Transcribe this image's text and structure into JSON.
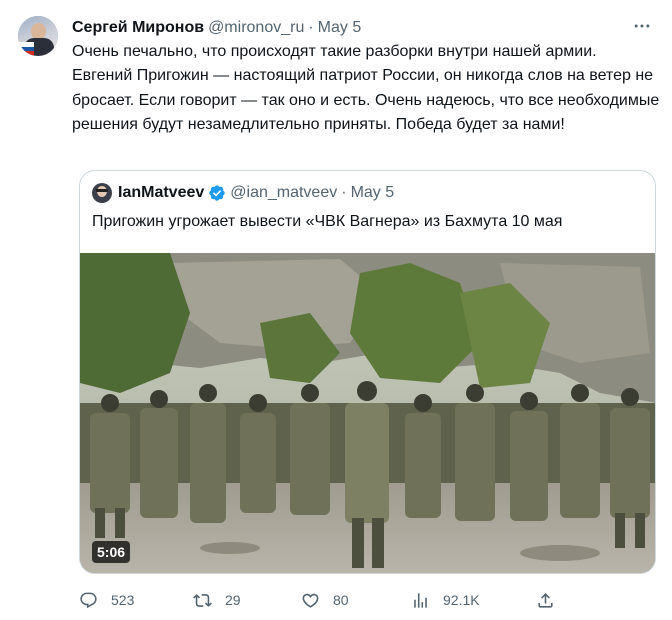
{
  "tweet": {
    "author_name": "Сергей Миронов",
    "handle": "@mironov_ru",
    "separator": "·",
    "date": "May 5",
    "avatar_icon": "profile-photo-with-russian-flag",
    "text": "Очень печально, что происходят такие разборки внутри нашей армии. Евгений Пригожин — настоящий патриот России, он никогда слов на ветер не бросает. Если говорит — так оно и есть. Очень надеюсь, что все необходимые решения будут незамедлительно приняты. Победа будет за нами!"
  },
  "quote": {
    "author_name": "IanMatveev",
    "handle": "@ian_matveev",
    "separator": "·",
    "date": "May 5",
    "verified_icon": "verified-badge-icon",
    "verified_color": "#1d9bf0",
    "text": "Пригожин угрожает вывести «ЧВК Вагнера» из Бахмута 10 мая",
    "video_duration": "5:06"
  },
  "actions": {
    "replies": "523",
    "retweets": "29",
    "likes": "80",
    "views": "92.1K",
    "icons": [
      "reply-icon",
      "retweet-icon",
      "like-icon",
      "views-icon",
      "share-icon"
    ]
  },
  "colors": {
    "text": "#0f1419",
    "secondary": "#536471",
    "border": "#cfd9de"
  }
}
